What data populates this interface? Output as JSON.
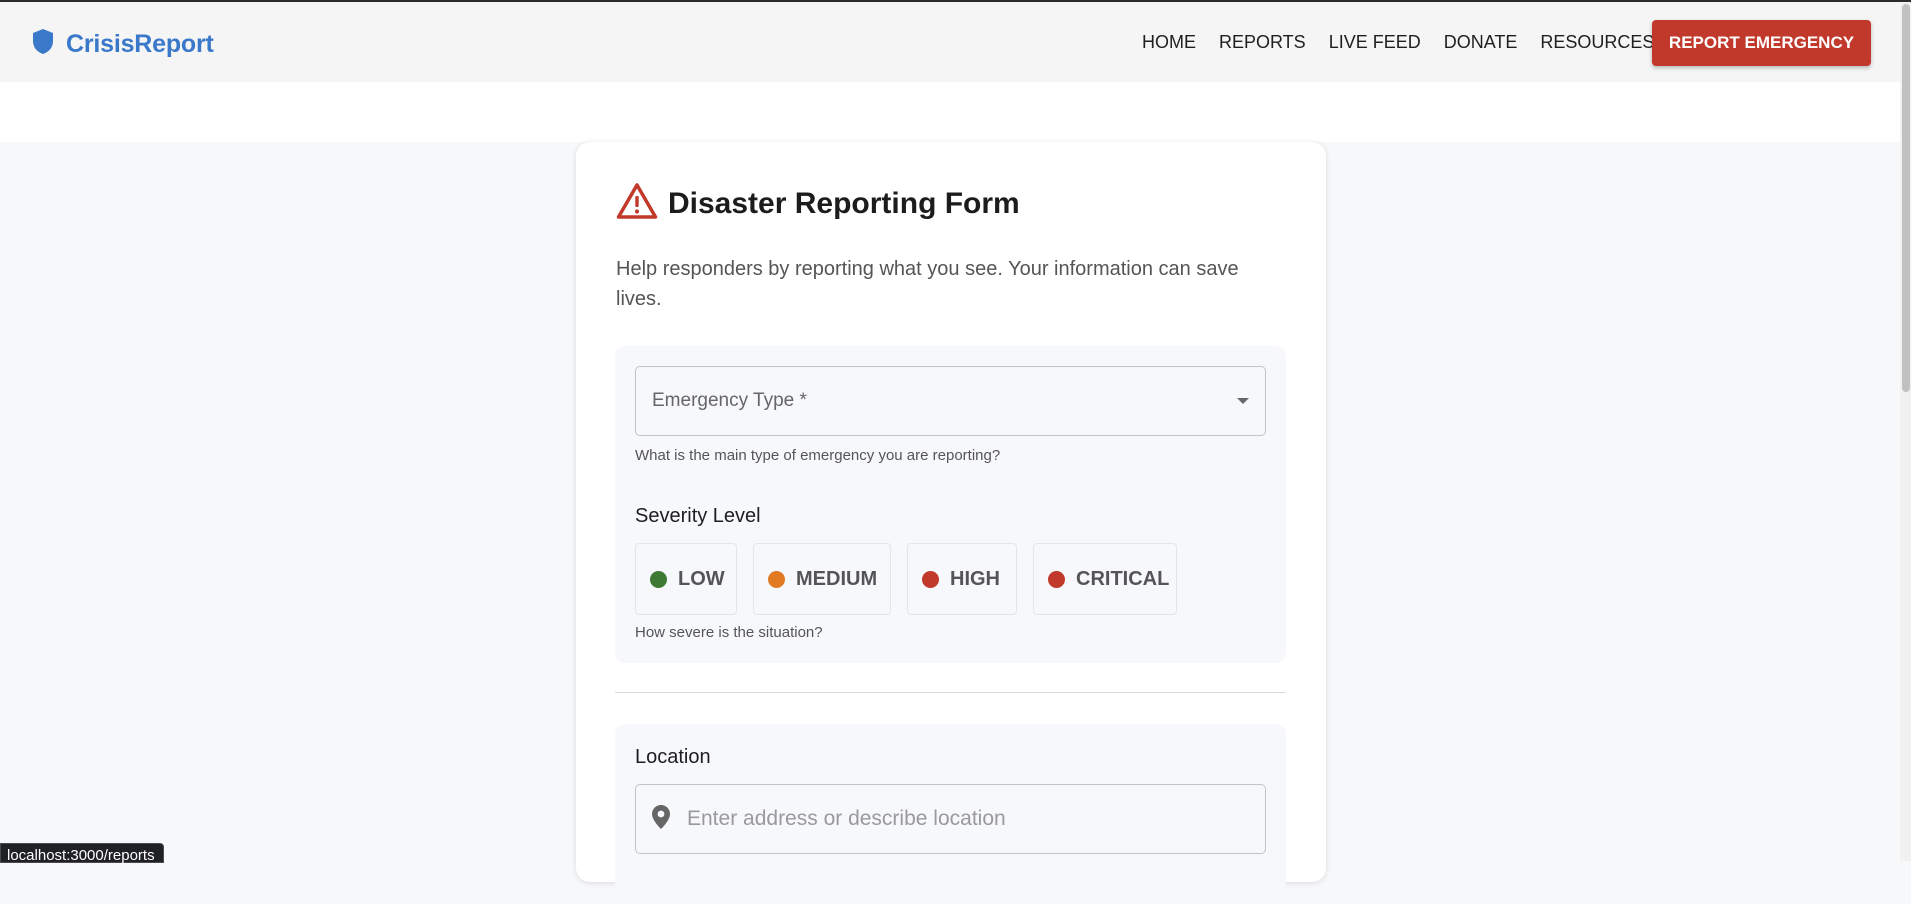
{
  "brand": {
    "name": "CrisisReport",
    "icon": "shield-icon"
  },
  "nav": {
    "links": [
      "HOME",
      "REPORTS",
      "LIVE FEED",
      "DONATE",
      "RESOURCES"
    ],
    "cta_label": "REPORT EMERGENCY"
  },
  "form": {
    "title": "Disaster Reporting Form",
    "title_icon": "warning-icon",
    "subtitle": "Help responders by reporting what you see. Your information can save lives.",
    "emergency_type": {
      "label": "Emergency Type *",
      "helper": "What is the main type of emergency you are reporting?"
    },
    "severity": {
      "label": "Severity Level",
      "options": [
        {
          "label": "LOW",
          "color": "#3f7a35"
        },
        {
          "label": "MEDIUM",
          "color": "#e07b24"
        },
        {
          "label": "HIGH",
          "color": "#c0392b"
        },
        {
          "label": "CRITICAL",
          "color": "#c0392b"
        }
      ],
      "helper": "How severe is the situation?"
    },
    "location": {
      "label": "Location",
      "placeholder": "Enter address or describe location",
      "icon": "map-pin-icon"
    }
  },
  "status_bar": {
    "url": "localhost:3000/reports"
  },
  "colors": {
    "brand_blue": "#3a78c9",
    "danger_red": "#c0392b"
  }
}
